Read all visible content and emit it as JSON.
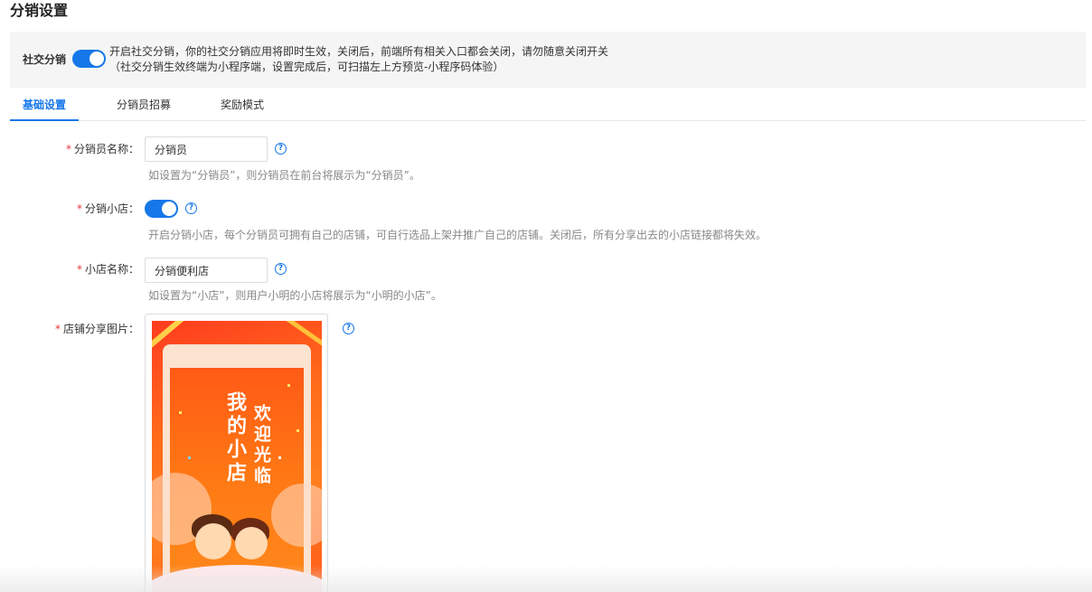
{
  "page": {
    "title": "分销设置"
  },
  "banner": {
    "label": "社交分销",
    "enabled": true,
    "line1": "开启社交分销，你的社交分销应用将即时生效，关闭后，前端所有相关入口都会关闭，请勿随意关闭开关",
    "line2": "（社交分销生效终端为小程序端，设置完成后，可扫描左上方预览-小程序码体验）"
  },
  "tabs": [
    {
      "label": "基础设置",
      "active": true
    },
    {
      "label": "分销员招募",
      "active": false
    },
    {
      "label": "奖励模式",
      "active": false
    }
  ],
  "form": {
    "required_mark": "*",
    "help_glyph": "?",
    "distributor_name": {
      "label": "分销员名称：",
      "value": "分销员",
      "hint": "如设置为“分销员”，则分销员在前台将展示为“分销员”。"
    },
    "distribution_shop": {
      "label": "分销小店：",
      "enabled": true,
      "hint": "开启分销小店，每个分销员可拥有自己的店铺，可自行选品上架并推广自己的店铺。关闭后，所有分享出去的小店链接都将失效。"
    },
    "shop_name": {
      "label": "小店名称：",
      "value": "分销便利店",
      "hint": "如设置为“小店”，则用户小明的小店将展示为“小明的小店”。"
    },
    "share_image": {
      "label": "店铺分享图片：",
      "poster_text_left": "我的小店",
      "poster_text_right": "欢迎光临"
    }
  },
  "colors": {
    "accent": "#1677e8",
    "required": "#e4393c",
    "hint": "#888888",
    "banner_bg": "#f5f5f5"
  }
}
